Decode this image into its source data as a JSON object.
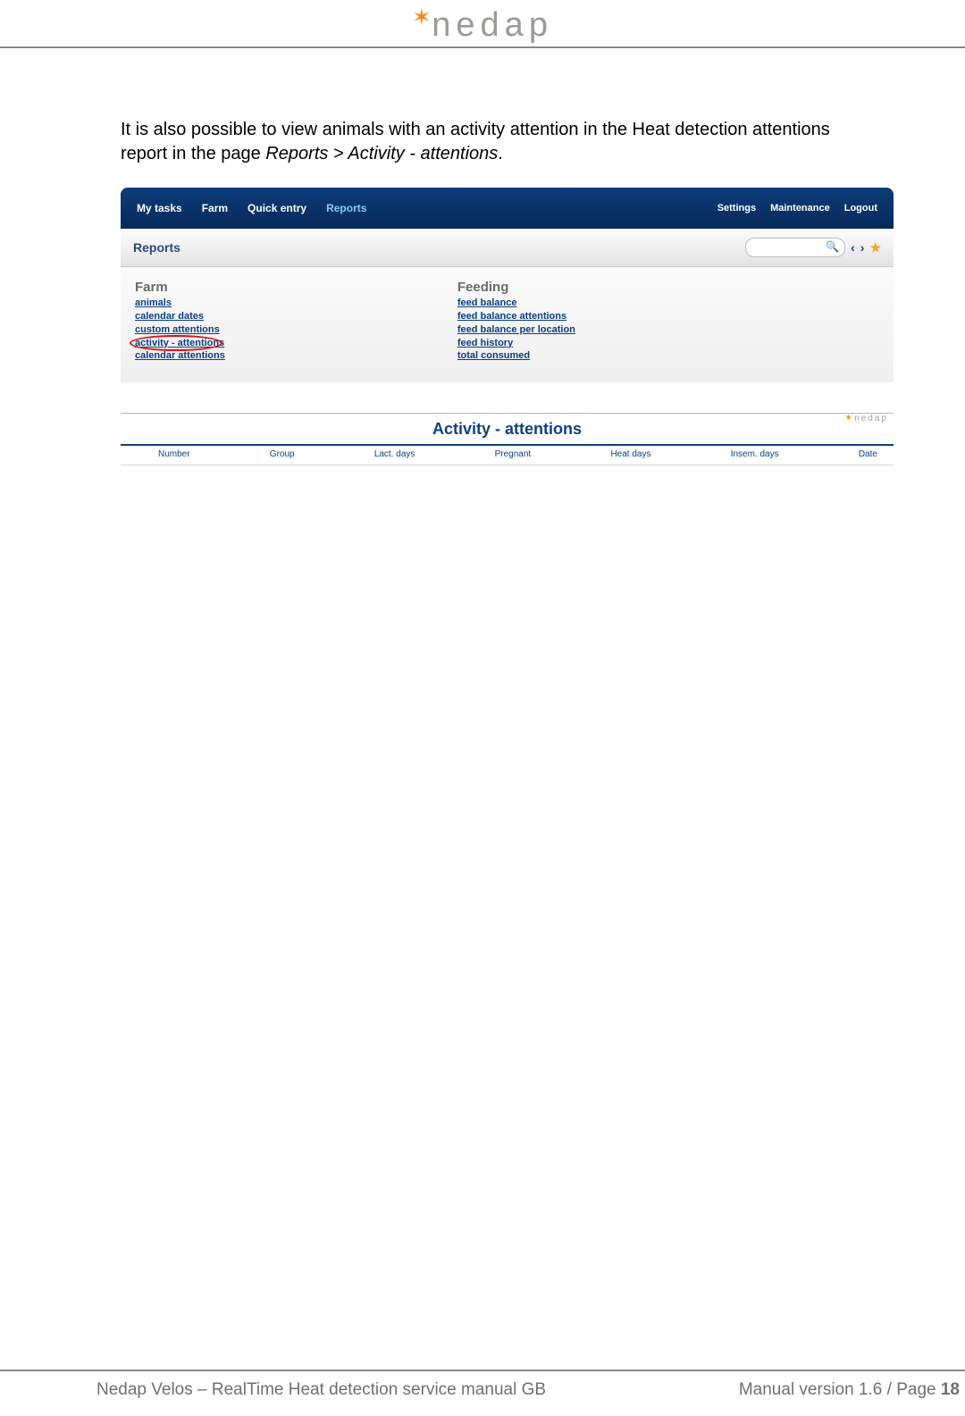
{
  "header": {
    "brand": "nedap"
  },
  "intro": {
    "text_before": "It is also possible to view animals with an activity attention in the Heat detection attentions report in the page ",
    "path_italic": "Reports > Activity - attentions",
    "period": "."
  },
  "screenshot1": {
    "nav_left": [
      "My tasks",
      "Farm",
      "Quick entry",
      "Reports"
    ],
    "nav_active_index": 3,
    "nav_right": [
      "Settings",
      "Maintenance",
      "Logout"
    ],
    "subtitle": "Reports",
    "farm_heading": "Farm",
    "farm_links": [
      "animals",
      "calendar dates",
      "custom attentions",
      "activity - attentions",
      "calendar attentions"
    ],
    "farm_circled_index": 3,
    "feeding_heading": "Feeding",
    "feeding_links": [
      "feed balance",
      "feed balance attentions",
      "feed balance per location",
      "feed history",
      "total consumed"
    ]
  },
  "screenshot2": {
    "title": "Activity - attentions",
    "brand": "nedap",
    "columns": [
      "Number",
      "Group",
      "Lact. days",
      "Pregnant",
      "Heat days",
      "Insem. days",
      "Date"
    ]
  },
  "footer": {
    "left": "Nedap Velos – RealTime Heat detection service manual GB",
    "right_prefix": "Manual version 1.6 / Page ",
    "page": "18"
  }
}
